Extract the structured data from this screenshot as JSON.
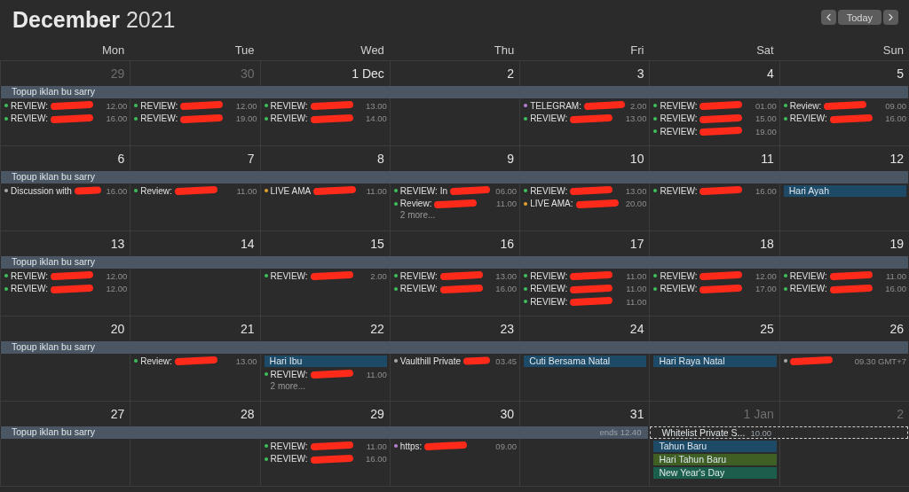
{
  "header": {
    "month": "December",
    "year": "2021",
    "nav": {
      "today": "Today"
    }
  },
  "weekdays": [
    "Mon",
    "Tue",
    "Wed",
    "Thu",
    "Fri",
    "Sat",
    "Sun"
  ],
  "weeks": [
    {
      "spans": [
        {
          "title": "Topup iklan bu sarry",
          "dashed": false,
          "days": [
            {
              "date": "29",
              "muted": true,
              "events": [
                {
                  "kind": "timed",
                  "title": "REVIEW:",
                  "time": "12.00",
                  "color": "#3fbf5a",
                  "redacted": true
                },
                {
                  "kind": "timed",
                  "title": "REVIEW:",
                  "time": "16.00",
                  "color": "#3fbf5a",
                  "redacted": true
                }
              ]
            },
            {
              "date": "30",
              "muted": true,
              "events": [
                {
                  "kind": "timed",
                  "title": "REVIEW:",
                  "time": "12.00",
                  "color": "#3fbf5a",
                  "redacted": true
                },
                {
                  "kind": "timed",
                  "title": "REVIEW:",
                  "time": "19.00",
                  "color": "#3fbf5a",
                  "redacted": true
                }
              ]
            },
            {
              "date": "1 Dec",
              "muted": false,
              "events": [
                {
                  "kind": "timed",
                  "title": "REVIEW:",
                  "time": "13.00",
                  "color": "#3fbf5a",
                  "redacted": true
                },
                {
                  "kind": "timed",
                  "title": "REVIEW:",
                  "time": "14.00",
                  "color": "#3fbf5a",
                  "redacted": true
                }
              ]
            },
            {
              "date": "2",
              "muted": false
            },
            {
              "date": "3",
              "muted": false,
              "events": [
                {
                  "kind": "timed",
                  "title": "TELEGRAM:",
                  "time": "2.00",
                  "color": "#b57fd0",
                  "redacted": true
                },
                {
                  "kind": "timed",
                  "title": "REVIEW:",
                  "time": "13.00",
                  "color": "#3fbf5a",
                  "redacted": true
                }
              ]
            },
            {
              "date": "4",
              "muted": false,
              "events": [
                {
                  "kind": "timed",
                  "title": "REVIEW:",
                  "time": "01.00",
                  "color": "#3fbf5a",
                  "redacted": true
                },
                {
                  "kind": "timed",
                  "title": "REVIEW:",
                  "time": "15.00",
                  "color": "#3fbf5a",
                  "redacted": true
                },
                {
                  "kind": "timed",
                  "title": "REVIEW:",
                  "time": "19.00",
                  "color": "#3fbf5a",
                  "redacted": true
                }
              ]
            },
            {
              "date": "5",
              "muted": false,
              "events": [
                {
                  "kind": "timed",
                  "title": "Review:",
                  "time": "09.00",
                  "color": "#3fbf5a",
                  "redacted": true
                },
                {
                  "kind": "timed",
                  "title": "REVIEW:",
                  "time": "16.00",
                  "color": "#3fbf5a",
                  "redacted": true
                }
              ]
            }
          ]
        }
      ]
    },
    {
      "spans": [
        {
          "title": "Topup iklan bu sarry",
          "dashed": false,
          "days": [
            {
              "date": "6",
              "muted": false,
              "events": [
                {
                  "kind": "timed",
                  "title": "Discussion with",
                  "time": "16.00",
                  "color": "#a8a8a8",
                  "redacted": true
                }
              ]
            },
            {
              "date": "7",
              "muted": false,
              "events": [
                {
                  "kind": "timed",
                  "title": "Review:",
                  "time": "11.00",
                  "color": "#3fbf5a",
                  "redacted": true
                }
              ]
            },
            {
              "date": "8",
              "muted": false,
              "events": [
                {
                  "kind": "timed",
                  "title": "LIVE AMA",
                  "time": "11.00",
                  "color": "#e0a030",
                  "redacted": true
                }
              ]
            },
            {
              "date": "9",
              "muted": false,
              "events": [
                {
                  "kind": "timed",
                  "title": "REVIEW: In",
                  "time": "06.00",
                  "color": "#3fbf5a",
                  "redacted": true
                },
                {
                  "kind": "timed",
                  "title": "Review:",
                  "time": "11.00",
                  "color": "#3fbf5a",
                  "redacted": true
                },
                {
                  "kind": "more",
                  "title": "2 more..."
                }
              ]
            },
            {
              "date": "10",
              "muted": false,
              "events": [
                {
                  "kind": "timed",
                  "title": "REVIEW:",
                  "time": "13.00",
                  "color": "#3fbf5a",
                  "redacted": true
                },
                {
                  "kind": "timed",
                  "title": "LIVE AMA:",
                  "time": "20.00",
                  "color": "#e0a030",
                  "redacted": true
                }
              ]
            },
            {
              "date": "11",
              "muted": false,
              "events": [
                {
                  "kind": "timed",
                  "title": "REVIEW:",
                  "time": "16.00",
                  "color": "#3fbf5a",
                  "redacted": true
                }
              ]
            },
            {
              "date": "12",
              "muted": false,
              "events": [
                {
                  "kind": "allday",
                  "title": "Hari Ayah",
                  "color": "#1d4a66"
                }
              ]
            }
          ]
        }
      ]
    },
    {
      "spans": [
        {
          "title": "Topup iklan bu sarry",
          "dashed": false,
          "days": [
            {
              "date": "13",
              "muted": false,
              "events": [
                {
                  "kind": "timed",
                  "title": "REVIEW:",
                  "time": "12.00",
                  "color": "#3fbf5a",
                  "redacted": true
                },
                {
                  "kind": "timed",
                  "title": "REVIEW:",
                  "time": "12.00",
                  "color": "#3fbf5a",
                  "redacted": true
                }
              ]
            },
            {
              "date": "14",
              "muted": false
            },
            {
              "date": "15",
              "muted": false,
              "events": [
                {
                  "kind": "timed",
                  "title": "REVIEW:",
                  "time": "2.00",
                  "color": "#3fbf5a",
                  "redacted": true
                }
              ]
            },
            {
              "date": "16",
              "muted": false,
              "events": [
                {
                  "kind": "timed",
                  "title": "REVIEW:",
                  "time": "13.00",
                  "color": "#3fbf5a",
                  "redacted": true
                },
                {
                  "kind": "timed",
                  "title": "REVIEW:",
                  "time": "16.00",
                  "color": "#3fbf5a",
                  "redacted": true
                }
              ]
            },
            {
              "date": "17",
              "muted": false,
              "events": [
                {
                  "kind": "timed",
                  "title": "REVIEW:",
                  "time": "11.00",
                  "color": "#3fbf5a",
                  "redacted": true
                },
                {
                  "kind": "timed",
                  "title": "REVIEW:",
                  "time": "11.00",
                  "color": "#3fbf5a",
                  "redacted": true
                },
                {
                  "kind": "timed",
                  "title": "REVIEW:",
                  "time": "11.00",
                  "color": "#3fbf5a",
                  "redacted": true
                }
              ]
            },
            {
              "date": "18",
              "muted": false,
              "events": [
                {
                  "kind": "timed",
                  "title": "REVIEW:",
                  "time": "12.00",
                  "color": "#3fbf5a",
                  "redacted": true
                },
                {
                  "kind": "timed",
                  "title": "REVIEW:",
                  "time": "17.00",
                  "color": "#3fbf5a",
                  "redacted": true
                }
              ]
            },
            {
              "date": "19",
              "muted": false,
              "events": [
                {
                  "kind": "timed",
                  "title": "REVIEW:",
                  "time": "11.00",
                  "color": "#3fbf5a",
                  "redacted": true
                },
                {
                  "kind": "timed",
                  "title": "REVIEW:",
                  "time": "16.00",
                  "color": "#3fbf5a",
                  "redacted": true
                }
              ]
            }
          ]
        }
      ]
    },
    {
      "spans": [
        {
          "title": "Topup iklan bu sarry",
          "dashed": false,
          "days": [
            {
              "date": "20",
              "muted": false
            },
            {
              "date": "21",
              "muted": false,
              "events": [
                {
                  "kind": "timed",
                  "title": "Review:",
                  "time": "13.00",
                  "color": "#3fbf5a",
                  "redacted": true
                }
              ]
            },
            {
              "date": "22",
              "muted": false,
              "events": [
                {
                  "kind": "allday",
                  "title": "Hari Ibu",
                  "color": "#1d4a66"
                },
                {
                  "kind": "timed",
                  "title": "REVIEW:",
                  "time": "11.00",
                  "color": "#3fbf5a",
                  "redacted": true
                },
                {
                  "kind": "more",
                  "title": "2 more..."
                }
              ]
            },
            {
              "date": "23",
              "muted": false,
              "events": [
                {
                  "kind": "timed",
                  "title": "Vaulthill Private",
                  "time": "03.45",
                  "color": "#a8a8a8",
                  "redacted": true
                }
              ]
            },
            {
              "date": "24",
              "muted": false,
              "events": [
                {
                  "kind": "allday",
                  "title": "Cuti Bersama Natal",
                  "color": "#1d4a66"
                }
              ]
            },
            {
              "date": "25",
              "muted": false,
              "events": [
                {
                  "kind": "allday",
                  "title": "Hari Raya Natal",
                  "color": "#1d4a66"
                }
              ]
            },
            {
              "date": "26",
              "muted": false,
              "events": [
                {
                  "kind": "timed",
                  "time": "09.30 GMT+7",
                  "color": "#a8a8a8",
                  "redacted": true
                }
              ]
            }
          ]
        }
      ]
    },
    {
      "spans": [
        {
          "title": "Topup iklan bu sarry",
          "ends": "ends 12.40",
          "dashed": false,
          "days": [
            {
              "date": "27",
              "muted": false
            },
            {
              "date": "28",
              "muted": false
            },
            {
              "date": "29",
              "muted": false,
              "events": [
                {
                  "kind": "timed",
                  "title": "REVIEW:",
                  "time": "11.00",
                  "color": "#3fbf5a",
                  "redacted": true
                },
                {
                  "kind": "timed",
                  "title": "REVIEW:",
                  "time": "16.00",
                  "color": "#3fbf5a",
                  "redacted": true
                }
              ]
            },
            {
              "date": "30",
              "muted": false,
              "events": [
                {
                  "kind": "timed",
                  "title": "https:",
                  "time": "09.00",
                  "color": "#b57fd0",
                  "redacted": true
                }
              ]
            },
            {
              "date": "31",
              "muted": false
            }
          ]
        },
        {
          "title": "Whitelist Private S...",
          "time": "10.00",
          "dashed": true,
          "days": [
            {
              "date": "1 Jan",
              "muted": true,
              "events": [
                {
                  "kind": "allday",
                  "title": "Tahun Baru",
                  "color": "#1d4a66"
                },
                {
                  "kind": "allday",
                  "title": "Hari Tahun Baru",
                  "color": "#3f5f25"
                },
                {
                  "kind": "allday",
                  "title": "New Year's Day",
                  "color": "#1c5e4c"
                }
              ]
            },
            {
              "date": "2",
              "muted": true
            }
          ]
        }
      ]
    }
  ]
}
